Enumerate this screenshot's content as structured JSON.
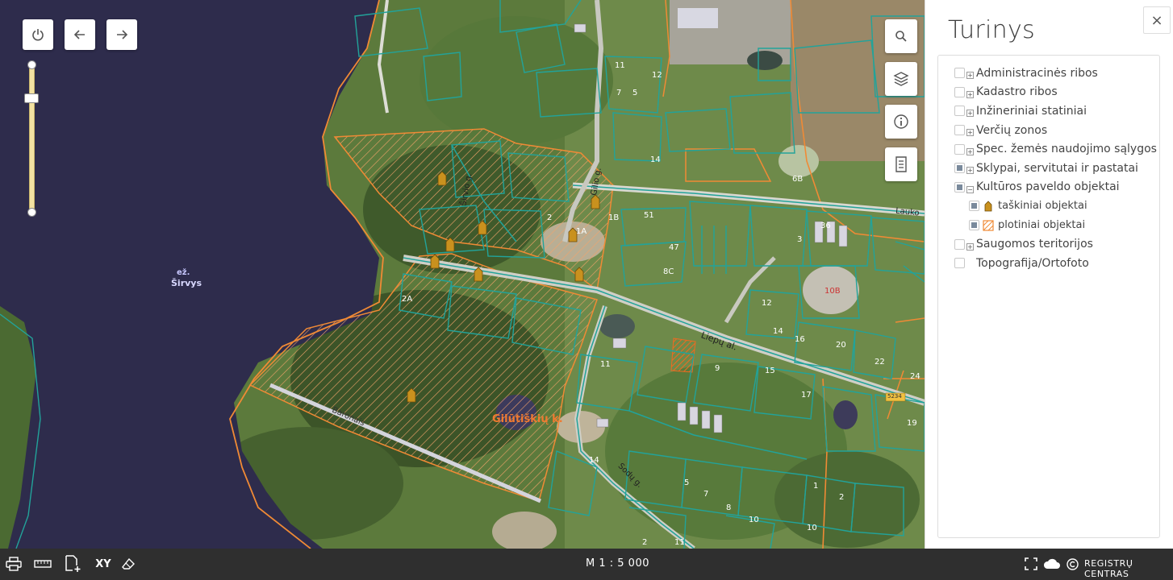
{
  "map": {
    "lake_label_line1": "ež.",
    "lake_label_line2": "Širvys",
    "village_label": "Gilūtiškių k.",
    "streets": [
      "Baronais",
      "Liepų al.",
      "Sodų g.",
      "Lauko",
      "Gilio g.",
      "Širvio g."
    ],
    "road_number": "5234",
    "parcel_numbers": [
      "11",
      "12",
      "7",
      "5",
      "14",
      "6B",
      "1A",
      "1B",
      "2",
      "51",
      "47",
      "3",
      "36",
      "8C",
      "10B",
      "12",
      "14",
      "16",
      "20",
      "22",
      "24",
      "11",
      "9",
      "15",
      "17",
      "19",
      "14",
      "5",
      "7",
      "11",
      "2",
      "8",
      "10",
      "10",
      "2A",
      "1",
      "2"
    ],
    "buttons": {
      "power": "power-icon",
      "back": "arrow-left-icon",
      "forward": "arrow-right-icon",
      "search": "search-icon",
      "layers": "layers-icon",
      "info": "info-icon",
      "legend": "document-icon"
    }
  },
  "panel": {
    "title": "Turinys",
    "close_label": "×",
    "layers": [
      {
        "label": "Administracinės ribos",
        "state": "unchecked",
        "expander": "+"
      },
      {
        "label": "Kadastro ribos",
        "state": "unchecked",
        "expander": "+"
      },
      {
        "label": "Inžineriniai statiniai",
        "state": "unchecked",
        "expander": "+"
      },
      {
        "label": "Verčių zonos",
        "state": "unchecked",
        "expander": "+"
      },
      {
        "label": "Spec. žemės naudojimo sąlygos",
        "state": "unchecked",
        "expander": "+"
      },
      {
        "label": "Sklypai, servitutai ir pastatai",
        "state": "partial",
        "expander": "+"
      },
      {
        "label": "Kultūros paveldo objektai",
        "state": "partial",
        "expander": "−"
      },
      {
        "label": "taškiniai objektai",
        "state": "partial",
        "sub": true,
        "symbol": "point"
      },
      {
        "label": "plotiniai objektai",
        "state": "partial",
        "sub": true,
        "symbol": "area"
      },
      {
        "label": "Saugomos teritorijos",
        "state": "unchecked",
        "expander": "+"
      },
      {
        "label": "Topografija/Ortofoto",
        "state": "unchecked",
        "expander": ""
      }
    ]
  },
  "bottom": {
    "scale": "M 1 : 5 000",
    "brand": "REGISTRŲ CENTRAS",
    "tools": [
      "print-icon",
      "ruler-icon",
      "add-file-icon",
      "XY",
      "eraser-icon"
    ],
    "right_tools": [
      "fullscreen-icon",
      "cloud-icon",
      "copyright-icon"
    ]
  },
  "colors": {
    "parcel_lines": "#22a39a",
    "heritage_lines": "#f08a35",
    "lake": "#2c2a4a",
    "panel_bg": "#ffffff",
    "bottom_bar": "#2f2f2f"
  }
}
